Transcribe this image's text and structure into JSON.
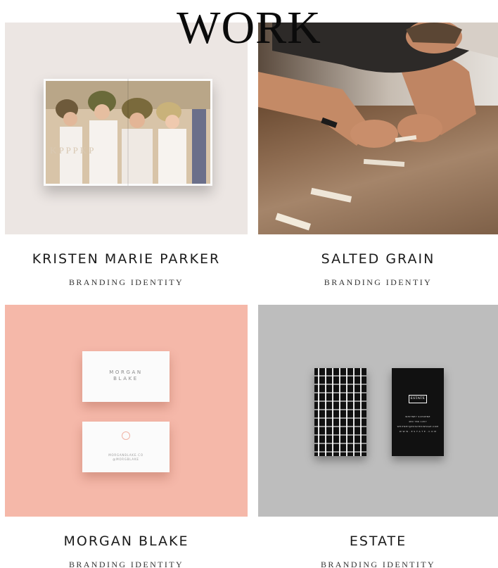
{
  "page": {
    "title": "WORK"
  },
  "projects": [
    {
      "title": "KRISTEN MARIE PARKER",
      "subtitle": "BRANDING IDENTITY",
      "mockup": {
        "mark": "K P P P K P"
      }
    },
    {
      "title": "SALTED GRAIN",
      "subtitle": "BRANDING IDENTIY"
    },
    {
      "title": "MORGAN BLAKE",
      "subtitle": "BRANDING IDENTITY",
      "mockup": {
        "logo_line1": "MORGAN",
        "logo_line2": "BLAKE",
        "back_line1": "MORGANBLAKE.CO",
        "back_line2": "@MORGBLAKE"
      }
    },
    {
      "title": "ESTATE",
      "subtitle": "BRANDING IDENTITY",
      "mockup": {
        "logo": "ESTATE",
        "line1": "WHITNEY SCHOENE",
        "line2": "480 786 1457",
        "line3": "WHITNEY@ESTATEVINTAGE.COM",
        "line4": "W W W . E S T A T E . C O M"
      }
    }
  ],
  "colors": {
    "kmp_bg": "#ece6e3",
    "morgan_blake_bg": "#f5b8a9",
    "estate_bg": "#bdbdbd"
  }
}
